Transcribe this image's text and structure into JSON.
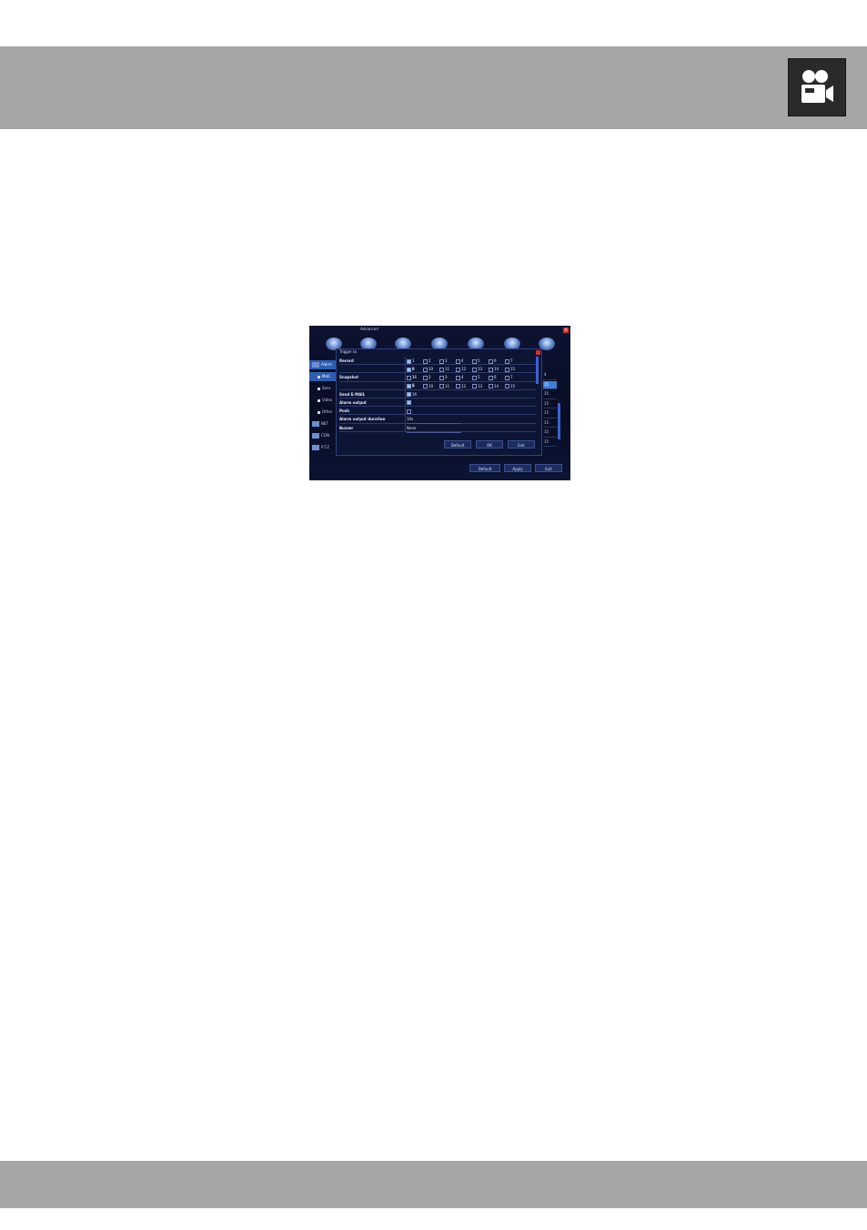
{
  "screen": {
    "window_title": "Advanced",
    "side_items": [
      {
        "label": "Alarm",
        "kind": "header",
        "active": true
      },
      {
        "label": "Moti",
        "kind": "sub",
        "active": true
      },
      {
        "label": "Sens",
        "kind": "sub",
        "active": false
      },
      {
        "label": "Video",
        "kind": "sub",
        "active": false
      },
      {
        "label": "Other",
        "kind": "sub",
        "active": false
      },
      {
        "label": "NET",
        "kind": "header",
        "active": false
      },
      {
        "label": "CON",
        "kind": "header",
        "active": false
      },
      {
        "label": "P.T.Z",
        "kind": "header",
        "active": false
      }
    ],
    "right_column": [
      "4",
      "15",
      "15",
      "15",
      "15",
      "15",
      "15",
      "15"
    ],
    "bottom_buttons": [
      "Default",
      "Apply",
      "Exit"
    ]
  },
  "dialog": {
    "title": "Trigger to",
    "rows": [
      {
        "label": "Record",
        "type": "channels",
        "channels": [
          "1",
          "2",
          "3",
          "4",
          "5",
          "6",
          "7",
          "8"
        ],
        "checked": [
          true,
          false,
          false,
          false,
          false,
          false,
          false,
          false
        ]
      },
      {
        "label": "",
        "type": "channels",
        "channels": [
          "9",
          "10",
          "11",
          "12",
          "13",
          "14",
          "15",
          "16"
        ],
        "checked": [
          true,
          false,
          false,
          false,
          false,
          false,
          false,
          false
        ]
      },
      {
        "label": "Snapshot",
        "type": "channels",
        "channels": [
          "1",
          "2",
          "3",
          "4",
          "5",
          "6",
          "7",
          "8"
        ],
        "checked": [
          false,
          false,
          false,
          false,
          false,
          false,
          false,
          false
        ]
      },
      {
        "label": "",
        "type": "channels",
        "channels": [
          "9",
          "10",
          "11",
          "12",
          "13",
          "14",
          "15",
          "16"
        ],
        "checked": [
          true,
          false,
          false,
          false,
          false,
          false,
          false,
          false
        ]
      },
      {
        "label": "Send E-MAIL",
        "type": "check",
        "checked": true
      },
      {
        "label": "Alarm output",
        "type": "check",
        "checked": true
      },
      {
        "label": "Push",
        "type": "check",
        "checked": false
      },
      {
        "label": "Alarm output duration",
        "type": "select",
        "value": "10s"
      },
      {
        "label": "Buzzer",
        "type": "select",
        "value": "None"
      }
    ],
    "buttons": [
      "Default",
      "OK",
      "Exit"
    ]
  }
}
